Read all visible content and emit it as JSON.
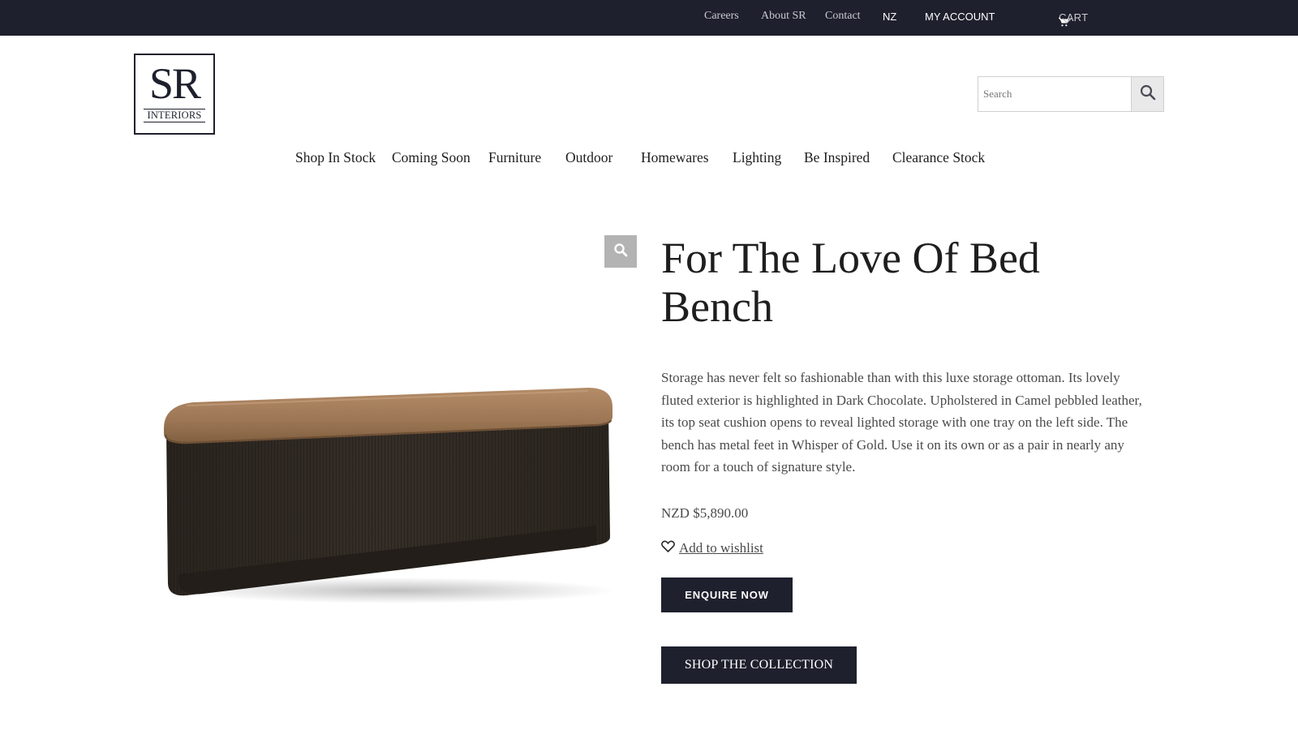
{
  "topbar": {
    "links": [
      "Careers",
      "About SR",
      "Contact"
    ],
    "region": "NZ",
    "account_label": "MY ACCOUNT",
    "cart_label": "CART",
    "background": "#1e202d"
  },
  "logo": {
    "monogram": "SR",
    "subtitle": "INTERIORS"
  },
  "search": {
    "placeholder": "Search",
    "value": ""
  },
  "nav": {
    "items": [
      "Shop In Stock",
      "Coming Soon",
      "Furniture",
      "Outdoor",
      "Homewares",
      "Lighting",
      "Be Inspired",
      "Clearance Stock"
    ]
  },
  "product": {
    "title": "For The Love Of Bed Bench",
    "description": "Storage has never felt so fashionable than with this luxe storage ottoman. Its lovely fluted exterior is highlighted in Dark Chocolate. Upholstered in Camel pebbled leather, its top seat cushion opens to reveal lighted storage with one tray on the left side. The bench has metal feet in Whisper of Gold. Use it on its own or as a pair in nearly any room for a touch of signature style.",
    "price": "NZD $5,890.00",
    "wishlist_label": "Add to wishlist",
    "enquire_label": "ENQUIRE NOW",
    "collection_label": "SHOP THE COLLECTION",
    "cushion_color": "#a07a57",
    "body_color": "#2e2822"
  },
  "icons": {
    "cart": "cart-icon",
    "chevron": "chevron-down-icon",
    "search": "search-icon",
    "zoom": "zoom-icon",
    "wishlist": "heart-icon"
  }
}
